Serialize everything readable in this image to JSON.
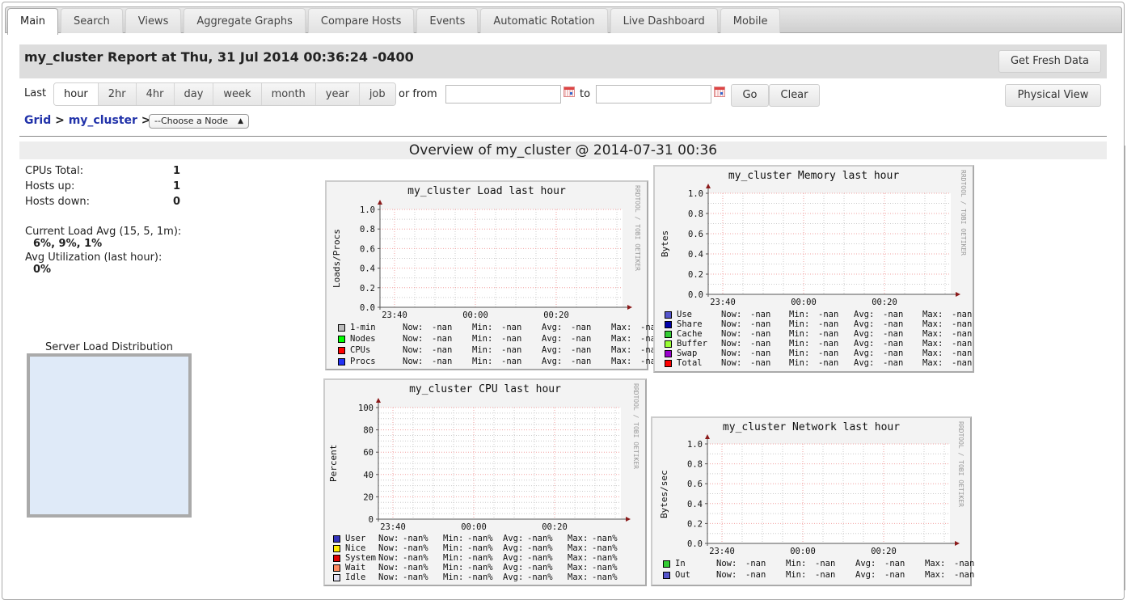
{
  "tabs": [
    {
      "label": "Main",
      "active": true
    },
    {
      "label": "Search"
    },
    {
      "label": "Views"
    },
    {
      "label": "Aggregate Graphs"
    },
    {
      "label": "Compare Hosts"
    },
    {
      "label": "Events"
    },
    {
      "label": "Automatic Rotation"
    },
    {
      "label": "Live Dashboard"
    },
    {
      "label": "Mobile"
    }
  ],
  "header": {
    "report_title": "my_cluster Report at Thu, 31 Jul 2014 00:36:24 -0400",
    "fresh_button": "Get Fresh Data",
    "physical_button": "Physical View"
  },
  "range": {
    "last_label": "Last",
    "options": [
      "hour",
      "2hr",
      "4hr",
      "day",
      "week",
      "month",
      "year",
      "job"
    ],
    "selected": "hour",
    "or_from_label": "or from",
    "to_label": "to",
    "from_value": "",
    "to_value": "",
    "go_button": "Go",
    "clear_button": "Clear"
  },
  "breadcrumb": {
    "grid": "Grid",
    "sep": ">",
    "cluster": "my_cluster",
    "node_select": "--Choose a Node"
  },
  "overview_title": "Overview of my_cluster @ 2014-07-31 00:36",
  "stats": {
    "cpus_total_label": "CPUs Total:",
    "cpus_total": "1",
    "hosts_up_label": "Hosts up:",
    "hosts_up": "1",
    "hosts_down_label": "Hosts down:",
    "hosts_down": "0",
    "load_avg_label": "Current Load Avg (15, 5, 1m):",
    "load_avg": "6%, 9%, 1%",
    "util_label": "Avg Utilization (last hour):",
    "util": "0%"
  },
  "server_load_title": "Server Load Distribution",
  "graphs": {
    "load": {
      "title": "my_cluster Load last hour",
      "ylabel": "Loads/Procs",
      "credit": "RRDTOOL / TOBI OETIKER",
      "legend": [
        {
          "name": "1-min",
          "color": "#bbbbbb",
          "now": "-nan",
          "min": "-nan",
          "avg": "-nan",
          "max": "-nan"
        },
        {
          "name": "Nodes",
          "color": "#00ff00",
          "now": "-nan",
          "min": "-nan",
          "avg": "-nan",
          "max": "-nan"
        },
        {
          "name": "CPUs",
          "color": "#ff0000",
          "now": "-nan",
          "min": "-nan",
          "avg": "-nan",
          "max": "-nan"
        },
        {
          "name": "Procs",
          "color": "#2030f5",
          "now": "-nan",
          "min": "-nan",
          "avg": "-nan",
          "max": "-nan"
        }
      ]
    },
    "memory": {
      "title": "my_cluster Memory last hour",
      "ylabel": "Bytes",
      "credit": "RRDTOOL / TOBI OETIKER",
      "legend": [
        {
          "name": "Use",
          "color": "#5555cc",
          "now": "-nan",
          "min": "-nan",
          "avg": "-nan",
          "max": "-nan"
        },
        {
          "name": "Share",
          "color": "#0000aa",
          "now": "-nan",
          "min": "-nan",
          "avg": "-nan",
          "max": "-nan"
        },
        {
          "name": "Cache",
          "color": "#33cc33",
          "now": "-nan",
          "min": "-nan",
          "avg": "-nan",
          "max": "-nan"
        },
        {
          "name": "Buffer",
          "color": "#99ff33",
          "now": "-nan",
          "min": "-nan",
          "avg": "-nan",
          "max": "-nan"
        },
        {
          "name": "Swap",
          "color": "#9900cc",
          "now": "-nan",
          "min": "-nan",
          "avg": "-nan",
          "max": "-nan"
        },
        {
          "name": "Total",
          "color": "#ff0000",
          "now": "-nan",
          "min": "-nan",
          "avg": "-nan",
          "max": "-nan"
        }
      ]
    },
    "cpu": {
      "title": "my_cluster CPU last hour",
      "ylabel": "Percent",
      "credit": "RRDTOOL / TOBI OETIKER",
      "legend": [
        {
          "name": "User",
          "color": "#3333bb",
          "now": "-nan%",
          "min": "-nan%",
          "avg": "-nan%",
          "max": "-nan%"
        },
        {
          "name": "Nice",
          "color": "#ffea00",
          "now": "-nan%",
          "min": "-nan%",
          "avg": "-nan%",
          "max": "-nan%"
        },
        {
          "name": "System",
          "color": "#dd0000",
          "now": "-nan%",
          "min": "-nan%",
          "avg": "-nan%",
          "max": "-nan%"
        },
        {
          "name": "Wait",
          "color": "#ff8a60",
          "now": "-nan%",
          "min": "-nan%",
          "avg": "-nan%",
          "max": "-nan%"
        },
        {
          "name": "Idle",
          "color": "#e2e2f2",
          "now": "-nan%",
          "min": "-nan%",
          "avg": "-nan%",
          "max": "-nan%"
        }
      ]
    },
    "network": {
      "title": "my_cluster Network last hour",
      "ylabel": "Bytes/sec",
      "credit": "RRDTOOL / TOBI OETIKER",
      "legend": [
        {
          "name": "In",
          "color": "#33cc33",
          "now": "-nan",
          "min": "-nan",
          "avg": "-nan",
          "max": "-nan"
        },
        {
          "name": "Out",
          "color": "#5555cc",
          "now": "-nan",
          "min": "-nan",
          "avg": "-nan",
          "max": "-nan"
        }
      ]
    }
  },
  "legend_labels": {
    "now": "Now:",
    "min": "Min:",
    "avg": "Avg:",
    "max": "Max:"
  },
  "chart_data": [
    {
      "type": "area",
      "title": "my_cluster Load last hour",
      "ylabel": "Loads/Procs",
      "xlabel": "",
      "x_ticks": [
        "23:40",
        "00:00",
        "00:20"
      ],
      "y_ticks": [
        "0.0",
        "0.2",
        "0.4",
        "0.6",
        "0.8",
        "1.0"
      ],
      "ylim": [
        0,
        1
      ],
      "grid": true,
      "series": [
        {
          "name": "1-min",
          "values": []
        },
        {
          "name": "Nodes",
          "values": []
        },
        {
          "name": "CPUs",
          "values": []
        },
        {
          "name": "Procs",
          "values": []
        }
      ]
    },
    {
      "type": "area",
      "title": "my_cluster Memory last hour",
      "ylabel": "Bytes",
      "xlabel": "",
      "x_ticks": [
        "23:40",
        "00:00",
        "00:20"
      ],
      "y_ticks": [
        "0.0",
        "0.2",
        "0.4",
        "0.6",
        "0.8",
        "1.0"
      ],
      "ylim": [
        0,
        1
      ],
      "grid": true,
      "series": [
        {
          "name": "Use",
          "values": []
        },
        {
          "name": "Share",
          "values": []
        },
        {
          "name": "Cache",
          "values": []
        },
        {
          "name": "Buffer",
          "values": []
        },
        {
          "name": "Swap",
          "values": []
        },
        {
          "name": "Total",
          "values": []
        }
      ]
    },
    {
      "type": "area",
      "title": "my_cluster CPU last hour",
      "ylabel": "Percent",
      "xlabel": "",
      "x_ticks": [
        "23:40",
        "00:00",
        "00:20"
      ],
      "y_ticks": [
        "0",
        "20",
        "40",
        "60",
        "80",
        "100"
      ],
      "ylim": [
        0,
        100
      ],
      "grid": true,
      "series": [
        {
          "name": "User",
          "values": []
        },
        {
          "name": "Nice",
          "values": []
        },
        {
          "name": "System",
          "values": []
        },
        {
          "name": "Wait",
          "values": []
        },
        {
          "name": "Idle",
          "values": []
        }
      ]
    },
    {
      "type": "line",
      "title": "my_cluster Network last hour",
      "ylabel": "Bytes/sec",
      "xlabel": "",
      "x_ticks": [
        "23:40",
        "00:00",
        "00:20"
      ],
      "y_ticks": [
        "0.0",
        "0.2",
        "0.4",
        "0.6",
        "0.8",
        "1.0"
      ],
      "ylim": [
        0,
        1
      ],
      "grid": true,
      "series": [
        {
          "name": "In",
          "values": []
        },
        {
          "name": "Out",
          "values": []
        }
      ]
    }
  ]
}
